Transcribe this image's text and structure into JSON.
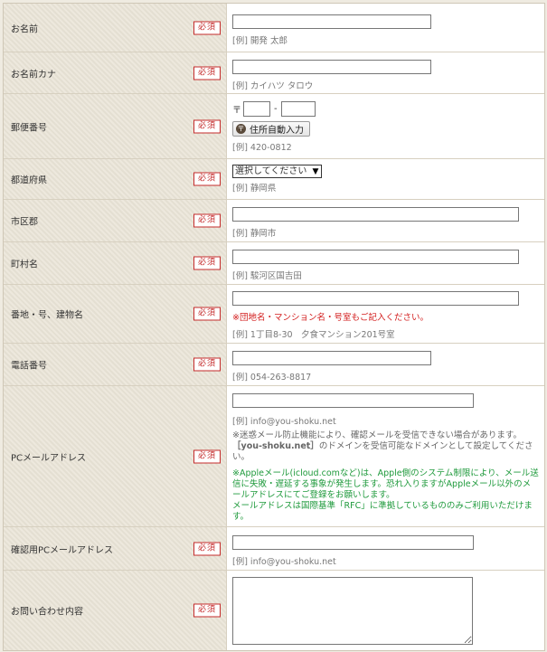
{
  "required_label": "必須",
  "fields": {
    "name": {
      "label": "お名前",
      "example": "[例] 開発 太郎",
      "value": ""
    },
    "kana": {
      "label": "お名前カナ",
      "example": "[例] カイハツ タロウ",
      "value": ""
    },
    "zip": {
      "label": "郵便番号",
      "symbol": "〒",
      "dash": "-",
      "button": "住所自動入力",
      "button_icon": "〒",
      "example": "[例] 420-0812"
    },
    "pref": {
      "label": "都道府県",
      "selected": "選択してください",
      "example": "[例] 静岡県"
    },
    "city": {
      "label": "市区郡",
      "example": "[例] 静岡市"
    },
    "town": {
      "label": "町村名",
      "example": "[例] 駿河区国吉田"
    },
    "address": {
      "label": "番地・号、建物名",
      "note": "※団地名・マンション名・号室もご記入ください。",
      "example": "[例] 1丁目8-30　夕食マンション201号室"
    },
    "tel": {
      "label": "電話番号",
      "example": "[例] 054-263-8817"
    },
    "email": {
      "label": "PCメールアドレス",
      "example": "[例] info@you-shoku.net",
      "note1": "※迷惑メール防止機能により、確認メールを受信できない場合があります。",
      "note2_domain": "［you-shoku.net］",
      "note2_rest": "のドメインを受信可能なドメインとして設定してください。",
      "note_apple": "※Appleメール(icloud.comなど)は、Apple側のシステム制限により、メール送信に失敗・遅延する事象が発生します。恐れ入りますがAppleメール以外のメールアドレスにてご登録をお願いします。",
      "note_rfc": "メールアドレスは国際基準「RFC」に準拠しているもののみご利用いただけます。"
    },
    "email_confirm": {
      "label": "確認用PCメールアドレス",
      "example": "[例] info@you-shoku.net"
    },
    "inquiry": {
      "label": "お問い合わせ内容"
    }
  }
}
